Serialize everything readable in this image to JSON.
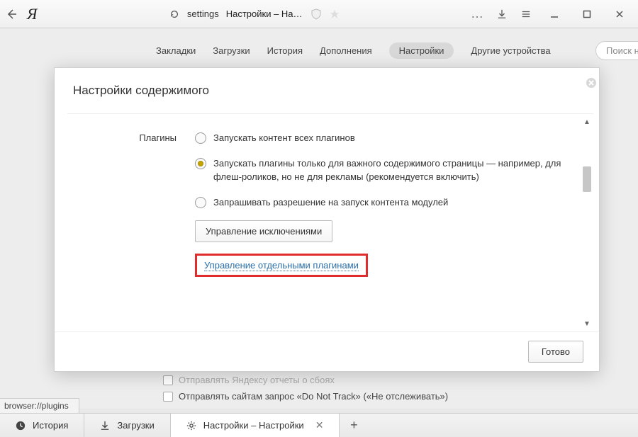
{
  "titlebar": {
    "url_host": "settings",
    "url_title": "Настройки – На…"
  },
  "nav": {
    "bookmarks": "Закладки",
    "downloads": "Загрузки",
    "history": "История",
    "addons": "Дополнения",
    "settings": "Настройки",
    "other_devices": "Другие устройства",
    "search_placeholder": "Поиск наст"
  },
  "modal": {
    "title": "Настройки содержимого",
    "section_label": "Плагины",
    "radio_all": "Запускать контент всех плагинов",
    "radio_important": "Запускать плагины только для важного содержимого страницы — например, для флеш-роликов, но не для рекламы (рекомендуется включить)",
    "radio_ask": "Запрашивать разрешение на запуск контента модулей",
    "exceptions_btn": "Управление исключениями",
    "plugins_link": "Управление отдельными плагинами",
    "done_btn": "Готово"
  },
  "bg": {
    "crash_reports": "Отправлять Яндексу отчеты о сбоях",
    "dnt": "Отправлять сайтам запрос «Do Not Track» («Не отслеживать»)"
  },
  "statusbar": {
    "text": "browser://plugins"
  },
  "tabs": {
    "history": "История",
    "downloads": "Загрузки",
    "settings": "Настройки – Настройки"
  }
}
